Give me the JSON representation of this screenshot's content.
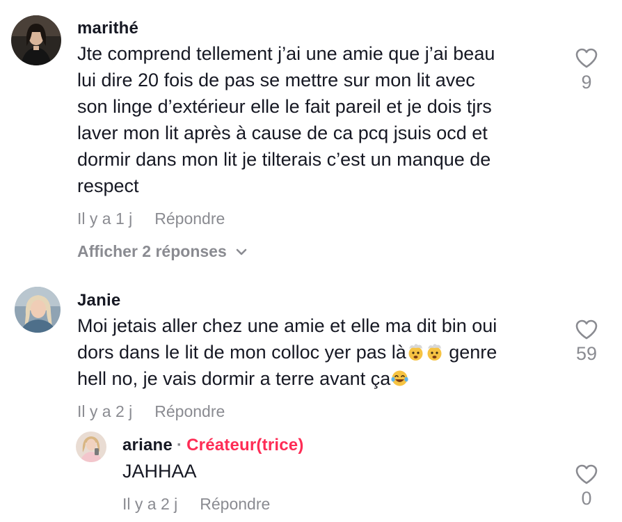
{
  "comments": [
    {
      "username": "marithé",
      "text_lines": [
        "Jte comprend tellement j’ai une amie que j’ai beau",
        "lui dire 20 fois de pas se mettre sur mon lit avec",
        "son linge d’extérieur elle le fait pareil et je dois tjrs",
        "laver mon lit après à cause de ca pcq jsuis ocd et",
        "dormir dans mon lit je tilterais c’est un manque de",
        "respect"
      ],
      "time": "Il y a 1 j",
      "reply_label": "Répondre",
      "likes": "9",
      "view_replies": "Afficher 2 réponses"
    },
    {
      "username": "Janie",
      "text_line1": "Moi jetais aller chez une amie et elle ma dit bin oui",
      "text_line2_a": "dors dans le lit de mon colloc yer pas là",
      "text_line2_b": " genre",
      "text_line3": "hell no, je vais dormir a terre avant ça",
      "time": "Il y a 2 j",
      "reply_label": "Répondre",
      "likes": "59"
    }
  ],
  "reply": {
    "username": "ariane",
    "separator": "·",
    "creator_label": "Créateur(trice)",
    "text": "JAHHAA",
    "time": "Il y a 2 j",
    "reply_label": "Répondre",
    "likes": "0"
  },
  "icons": {
    "like": "heart-outline-icon",
    "expand": "chevron-down-icon",
    "emoji_exploding": "exploding-head-emoji",
    "emoji_laugh": "tears-of-joy-emoji"
  },
  "colors": {
    "text": "#161823",
    "muted": "#8a8b91",
    "creator": "#fe2c55"
  }
}
